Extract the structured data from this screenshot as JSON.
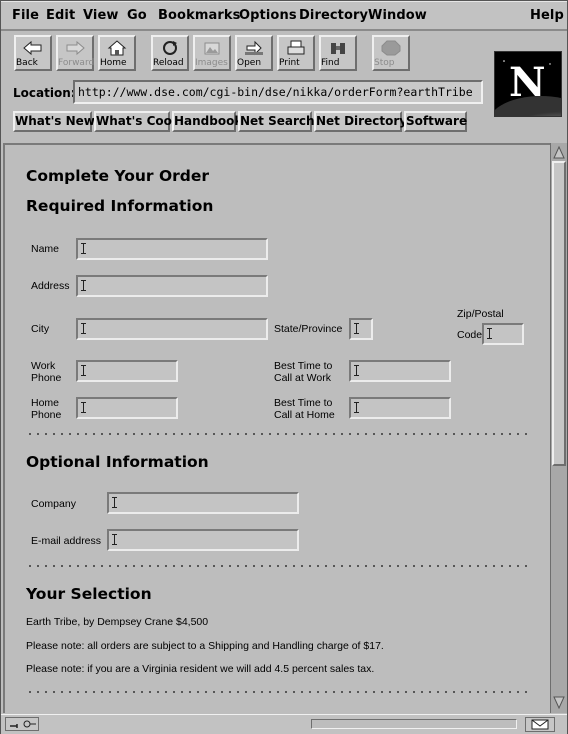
{
  "menu": {
    "items": [
      {
        "label": "File"
      },
      {
        "label": "Edit"
      },
      {
        "label": "View"
      },
      {
        "label": "Go"
      },
      {
        "label": "Bookmarks"
      },
      {
        "label": "Options"
      },
      {
        "label": "Directory"
      },
      {
        "label": "Window"
      }
    ],
    "help": "Help"
  },
  "toolbar": {
    "back": "Back",
    "forward": "Forward",
    "home": "Home",
    "reload": "Reload",
    "images": "Images",
    "open": "Open",
    "print": "Print",
    "find": "Find",
    "stop": "Stop"
  },
  "logo": {
    "letter": "N"
  },
  "location": {
    "label": "Location:",
    "url": "http://www.dse.com/cgi-bin/dse/nikka/orderForm?earthTribe"
  },
  "directory_buttons": {
    "whats_new": "What's New",
    "whats_cool": "What's Cool",
    "handbook": "Handbook",
    "net_search": "Net Search",
    "net_directory": "Net Directory",
    "software": "Software"
  },
  "page": {
    "title": "Complete Your Order",
    "required_heading": "Required Information",
    "fields": {
      "name": {
        "label": "Name",
        "value": ""
      },
      "address": {
        "label": "Address",
        "value": ""
      },
      "city": {
        "label": "City",
        "value": ""
      },
      "state": {
        "label": "State/Province",
        "value": ""
      },
      "zip": {
        "label1": "Zip/Postal",
        "label2": "Code",
        "value": ""
      },
      "work_phone": {
        "label1": "Work",
        "label2": "Phone",
        "value": ""
      },
      "best_work": {
        "label1": "Best Time to",
        "label2": "Call at Work",
        "value": ""
      },
      "home_phone": {
        "label1": "Home",
        "label2": "Phone",
        "value": ""
      },
      "best_home": {
        "label1": "Best Time to",
        "label2": "Call at Home",
        "value": ""
      }
    },
    "optional_heading": "Optional Information",
    "optional": {
      "company": {
        "label": "Company",
        "value": ""
      },
      "email": {
        "label": "E-mail address",
        "value": ""
      }
    },
    "selection_heading": "Your Selection",
    "selection_item": "Earth Tribe, by Dempsey Crane $4,500",
    "note_shipping": "Please note: all orders are subject to a Shipping and Handling charge of $17.",
    "note_tax": "Please note: if you are a Virginia resident we will add 4.5 percent sales tax."
  },
  "colors": {
    "window_bg": "#bdbdbd",
    "logo_bg": "#000000"
  }
}
